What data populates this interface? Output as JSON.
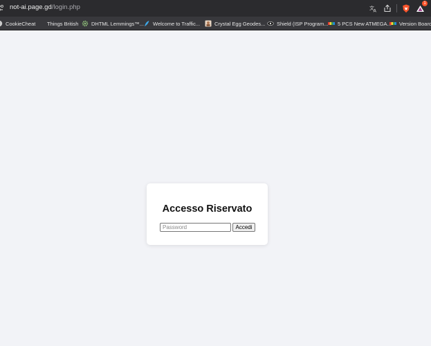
{
  "address_bar": {
    "url_host": "not-ai.page.gd",
    "url_path": "/login.php",
    "brave_notification_count": "1",
    "icons": [
      "translate-icon",
      "share-icon",
      "brave-shields-icon",
      "brave-rewards-icon"
    ]
  },
  "bookmarks": [
    {
      "label": "CookieCheat",
      "icon": "cookie-icon"
    },
    {
      "label": "Things British",
      "icon": "none"
    },
    {
      "label": "DHTML Lemmings™...",
      "icon": "gear-icon"
    },
    {
      "label": "Welcome to Traffic...",
      "icon": "feather-icon"
    },
    {
      "label": "Crystal Egg Geodes...",
      "icon": "photo-icon"
    },
    {
      "label": "Shield (ISP Program...",
      "icon": "eye-icon"
    },
    {
      "label": "5 PCS New ATMEGA...",
      "icon": "color-bar-icon"
    },
    {
      "label": "Version Board A",
      "icon": "color-bar-icon"
    }
  ],
  "login": {
    "title": "Accesso Riservato",
    "password_placeholder": "Password",
    "password_value": "",
    "submit_label": "Accedi"
  },
  "colors": {
    "page_background": "#f2f3f7",
    "toolbar": "#2b2b2e",
    "bookmarks_bar": "#38383c",
    "brave_orange": "#fb542b"
  }
}
